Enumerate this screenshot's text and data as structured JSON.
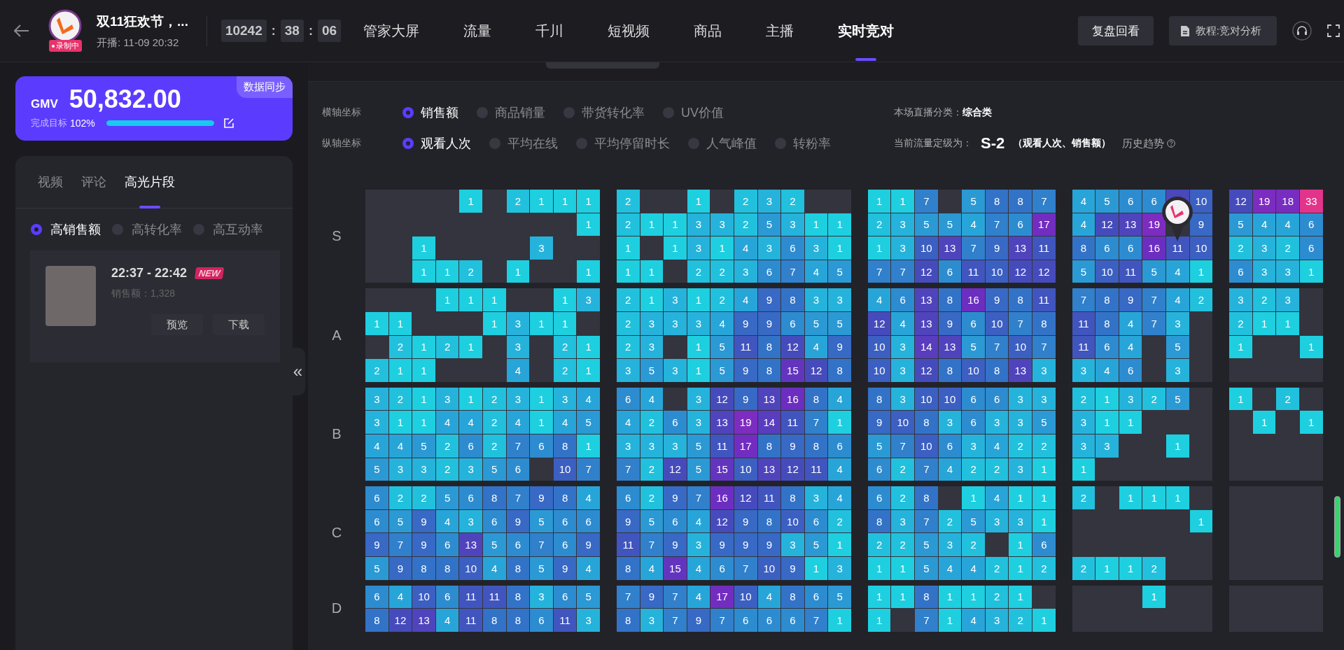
{
  "header": {
    "title": "双11狂欢节，...",
    "badge": "录制中",
    "start_time": "开播:  11-09 20:32",
    "timer": [
      {
        "text": "10242",
        "kind": "box"
      },
      {
        "text": ":",
        "kind": "sep"
      },
      {
        "text": "38",
        "kind": "box"
      },
      {
        "text": ":",
        "kind": "sep"
      },
      {
        "text": "06",
        "kind": "box"
      }
    ],
    "nav": [
      {
        "label": "管家大屏",
        "selected": false
      },
      {
        "label": "流量",
        "selected": false
      },
      {
        "label": "千川",
        "selected": false
      },
      {
        "label": "短视频",
        "selected": false
      },
      {
        "label": "商品",
        "selected": false
      },
      {
        "label": "主播",
        "selected": false
      },
      {
        "label": "实时竞对",
        "selected": true
      }
    ],
    "buttons": [
      {
        "label": "复盘回看",
        "kind": "plain"
      },
      {
        "label": "教程:竞对分析",
        "kind": "doc"
      }
    ]
  },
  "sidebar": {
    "gmv": {
      "label": "GMV",
      "value": "50,832.00",
      "sync": "数据同步",
      "target_label": "完成目标",
      "target_value": "102%",
      "level": 1
    },
    "tabs": [
      {
        "label": "视频",
        "selected": false
      },
      {
        "label": "评论",
        "selected": false
      },
      {
        "label": "高光片段",
        "selected": true
      }
    ],
    "filters": [
      {
        "label": "高销售额",
        "selected": true
      },
      {
        "label": "高转化率",
        "selected": false
      },
      {
        "label": "高互动率",
        "selected": false
      }
    ],
    "clips": [
      {
        "time": "22:37 - 22:42",
        "badge": "NEW",
        "sales": "销售额：1,328",
        "actions": [
          "预览",
          "下载"
        ]
      }
    ],
    "collapse": "«"
  },
  "filters": [
    {
      "label": "横轴坐标",
      "options": [
        {
          "label": "销售额",
          "selected": true
        },
        {
          "label": "商品销量",
          "selected": false
        },
        {
          "label": "带货转化率",
          "selected": false
        },
        {
          "label": "UV价值",
          "selected": false
        }
      ]
    },
    {
      "label": "纵轴坐标",
      "options": [
        {
          "label": "观看人次",
          "selected": true
        },
        {
          "label": "平均在线",
          "selected": false
        },
        {
          "label": "平均停留时长",
          "selected": false
        },
        {
          "label": "人气峰值",
          "selected": false
        },
        {
          "label": "转粉率",
          "selected": false
        }
      ]
    }
  ],
  "summary": {
    "category_label": "本场直播分类：",
    "category": "综合类",
    "grade_label": "当前流量定级为：",
    "grade": "S-2",
    "grade_basis": "（观看人次、销售额）",
    "history": "历史趋势"
  },
  "grid": {
    "rows": [
      {
        "label": "S",
        "blocks": [
          [
            [
              {
                "kind": "empty"
              },
              {
                "kind": "empty"
              },
              {
                "kind": "empty"
              },
              {
                "kind": "empty"
              },
              "1",
              {
                "kind": "empty"
              },
              "2",
              "1",
              "1",
              "1"
            ],
            [
              {
                "kind": "empty"
              },
              {
                "kind": "empty"
              },
              {
                "kind": "empty"
              },
              {
                "kind": "empty"
              },
              {
                "kind": "empty"
              },
              {
                "kind": "empty"
              },
              {
                "kind": "empty"
              },
              {
                "kind": "empty"
              },
              {
                "kind": "empty"
              },
              "1"
            ],
            [
              {
                "kind": "empty"
              },
              {
                "kind": "empty"
              },
              "1",
              {
                "kind": "empty"
              },
              {
                "kind": "empty"
              },
              {
                "kind": "empty"
              },
              {
                "kind": "empty"
              },
              "3",
              {
                "kind": "empty"
              },
              {
                "kind": "empty"
              }
            ],
            [
              {
                "kind": "empty"
              },
              {
                "kind": "empty"
              },
              "1",
              "1",
              "2",
              {
                "kind": "empty"
              },
              "1",
              {
                "kind": "empty"
              },
              {
                "kind": "empty"
              },
              "1"
            ]
          ],
          [
            [
              "2",
              {
                "kind": "empty"
              },
              {
                "kind": "empty"
              },
              "1",
              {
                "kind": "empty"
              },
              "2",
              "3",
              "2",
              {
                "kind": "empty"
              },
              {
                "kind": "empty"
              }
            ],
            [
              "2",
              "1",
              "1",
              "3",
              "3",
              "2",
              "5",
              "3",
              "1",
              "1"
            ],
            [
              "1",
              {
                "kind": "empty"
              },
              "1",
              "3",
              "1",
              "4",
              "3",
              "6",
              "3",
              "1"
            ],
            [
              "1",
              "1",
              {
                "kind": "empty"
              },
              "2",
              "2",
              "3",
              "6",
              "7",
              "4",
              "5"
            ]
          ],
          [
            [
              "1",
              "1",
              "7",
              {
                "kind": "empty"
              },
              "5",
              "8",
              "8",
              "7"
            ],
            [
              "2",
              "3",
              "5",
              "5",
              "4",
              "7",
              "6",
              "17"
            ],
            [
              "1",
              "3",
              "10",
              "13",
              "7",
              "9",
              "13",
              "11"
            ],
            [
              "7",
              "7",
              "12",
              "6",
              "11",
              "10",
              "12",
              "12"
            ]
          ],
          [
            [
              "4",
              "5",
              "6",
              "6",
              {
                "kind": "pin"
              },
              "10"
            ],
            [
              "4",
              "12",
              "13",
              "19",
              {
                "kind": "empty"
              },
              "9"
            ],
            [
              "8",
              "6",
              "6",
              "16",
              "11",
              "10"
            ],
            [
              "5",
              "10",
              "11",
              "5",
              "4",
              "1"
            ]
          ],
          [
            [
              "12",
              "19",
              "18",
              "33"
            ],
            [
              "5",
              "4",
              "4",
              "6"
            ],
            [
              "2",
              "3",
              "2",
              "6"
            ],
            [
              "6",
              "3",
              "3",
              "1"
            ]
          ]
        ]
      },
      {
        "label": "A",
        "blocks": [
          [
            [
              {
                "kind": "empty"
              },
              {
                "kind": "empty"
              },
              {
                "kind": "empty"
              },
              "1",
              "1",
              "1",
              {
                "kind": "empty"
              },
              {
                "kind": "empty"
              },
              "1",
              "3"
            ],
            [
              "1",
              "1",
              {
                "kind": "empty"
              },
              {
                "kind": "empty"
              },
              {
                "kind": "empty"
              },
              "1",
              "3",
              "1",
              "1",
              {
                "kind": "empty"
              }
            ],
            [
              {
                "kind": "empty"
              },
              "2",
              "1",
              "2",
              "1",
              {
                "kind": "empty"
              },
              "3",
              {
                "kind": "empty"
              },
              "2",
              "1"
            ],
            [
              "2",
              "1",
              "1",
              {
                "kind": "empty"
              },
              {
                "kind": "empty"
              },
              {
                "kind": "empty"
              },
              "4",
              {
                "kind": "empty"
              },
              "2",
              "1"
            ]
          ],
          [
            [
              "2",
              "1",
              "3",
              "1",
              "2",
              "4",
              "9",
              "8",
              "3",
              "3"
            ],
            [
              "2",
              "3",
              "3",
              "3",
              "4",
              "9",
              "9",
              "6",
              "5",
              "5"
            ],
            [
              "2",
              "3",
              {
                "kind": "empty"
              },
              "1",
              "5",
              "11",
              "8",
              "12",
              "4",
              "9"
            ],
            [
              "3",
              "5",
              "3",
              "1",
              "5",
              "9",
              "8",
              "15",
              "12",
              "8"
            ]
          ],
          [
            [
              "4",
              "6",
              "13",
              "8",
              "16",
              "9",
              "8",
              "11"
            ],
            [
              "12",
              "4",
              "13",
              "9",
              "6",
              "10",
              "7",
              "8"
            ],
            [
              "10",
              "3",
              "14",
              "13",
              "5",
              "7",
              "10",
              "7"
            ],
            [
              "10",
              "3",
              "12",
              "8",
              "10",
              "8",
              "13",
              "3"
            ]
          ],
          [
            [
              "7",
              "8",
              "9",
              "7",
              "4",
              "2"
            ],
            [
              "11",
              "8",
              "4",
              "7",
              "3",
              {
                "kind": "empty"
              }
            ],
            [
              "11",
              "6",
              "4",
              {
                "kind": "empty"
              },
              "5",
              {
                "kind": "empty"
              }
            ],
            [
              "3",
              "4",
              "6",
              {
                "kind": "empty"
              },
              "3",
              {
                "kind": "empty"
              }
            ]
          ],
          [
            [
              "3",
              "2",
              "3",
              {
                "kind": "empty"
              }
            ],
            [
              "2",
              "1",
              "1",
              {
                "kind": "empty"
              }
            ],
            [
              "1",
              {
                "kind": "empty"
              },
              {
                "kind": "empty"
              },
              "1"
            ],
            [
              {
                "kind": "empty"
              },
              {
                "kind": "empty"
              },
              {
                "kind": "empty"
              },
              {
                "kind": "empty"
              }
            ]
          ]
        ]
      },
      {
        "label": "B",
        "blocks": [
          [
            [
              "3",
              "2",
              "1",
              "3",
              "1",
              "2",
              "3",
              "1",
              "3",
              "4"
            ],
            [
              "3",
              "1",
              "1",
              "4",
              "4",
              "2",
              "4",
              "1",
              "4",
              "5"
            ],
            [
              "4",
              "4",
              "5",
              "2",
              "6",
              "2",
              "7",
              "6",
              "8",
              "1"
            ],
            [
              "5",
              "3",
              "3",
              "2",
              "3",
              "5",
              "6",
              {
                "kind": "empty"
              },
              "10",
              "7"
            ]
          ],
          [
            [
              "6",
              "4",
              {
                "kind": "empty"
              },
              "3",
              "12",
              "9",
              "13",
              "16",
              "8",
              "4"
            ],
            [
              "4",
              "2",
              "6",
              "3",
              "13",
              "19",
              "14",
              "11",
              "7",
              "1"
            ],
            [
              "3",
              "3",
              "3",
              "5",
              "11",
              "17",
              "8",
              "9",
              "8",
              "6"
            ],
            [
              "7",
              "2",
              "12",
              "5",
              "15",
              "10",
              "13",
              "12",
              "11",
              "4"
            ]
          ],
          [
            [
              "8",
              "3",
              "10",
              "10",
              "6",
              "6",
              "3",
              "3"
            ],
            [
              "9",
              "10",
              "8",
              "3",
              "6",
              "3",
              "3",
              "5"
            ],
            [
              "5",
              "7",
              "10",
              "6",
              "3",
              "4",
              "2",
              "2"
            ],
            [
              "6",
              "2",
              "7",
              "4",
              "2",
              "2",
              "3",
              "1"
            ]
          ],
          [
            [
              "2",
              "1",
              "3",
              "2",
              "5",
              {
                "kind": "empty"
              }
            ],
            [
              "3",
              "1",
              "1",
              {
                "kind": "empty"
              },
              {
                "kind": "empty"
              },
              {
                "kind": "empty"
              }
            ],
            [
              "3",
              "3",
              {
                "kind": "empty"
              },
              {
                "kind": "empty"
              },
              "1",
              {
                "kind": "empty"
              }
            ],
            [
              "1",
              {
                "kind": "empty"
              },
              {
                "kind": "empty"
              },
              {
                "kind": "empty"
              },
              {
                "kind": "empty"
              },
              {
                "kind": "empty"
              }
            ]
          ],
          [
            [
              "1",
              {
                "kind": "empty"
              },
              "2",
              {
                "kind": "empty"
              }
            ],
            [
              {
                "kind": "empty"
              },
              "1",
              {
                "kind": "empty"
              },
              "1"
            ],
            [
              {
                "kind": "empty"
              },
              {
                "kind": "empty"
              },
              {
                "kind": "empty"
              },
              {
                "kind": "empty"
              }
            ],
            [
              {
                "kind": "empty"
              },
              {
                "kind": "empty"
              },
              {
                "kind": "empty"
              },
              {
                "kind": "empty"
              }
            ]
          ]
        ]
      },
      {
        "label": "C",
        "blocks": [
          [
            [
              "6",
              "2",
              "2",
              "5",
              "6",
              "8",
              "7",
              "9",
              "8",
              "4"
            ],
            [
              "6",
              "5",
              "9",
              "4",
              "3",
              "6",
              "9",
              "5",
              "6",
              "6"
            ],
            [
              "9",
              "7",
              "9",
              "6",
              "13",
              "5",
              "6",
              "7",
              "6",
              "9"
            ],
            [
              "5",
              "9",
              "8",
              "8",
              "10",
              "4",
              "8",
              "5",
              "9",
              "4"
            ]
          ],
          [
            [
              "6",
              "2",
              "9",
              "7",
              "16",
              "12",
              "11",
              "8",
              "3",
              "4"
            ],
            [
              "9",
              "5",
              "6",
              "4",
              "12",
              "9",
              "8",
              "10",
              "6",
              "2"
            ],
            [
              "11",
              "7",
              "9",
              "3",
              "9",
              "9",
              "9",
              "3",
              "5",
              "1"
            ],
            [
              "8",
              "4",
              "15",
              "4",
              "6",
              "7",
              "10",
              "9",
              "1",
              "3"
            ]
          ],
          [
            [
              "6",
              "2",
              "8",
              {
                "kind": "empty"
              },
              "1",
              "4",
              "1",
              "1"
            ],
            [
              "8",
              "3",
              "7",
              "2",
              "5",
              "3",
              "3",
              "1"
            ],
            [
              "2",
              "2",
              "5",
              "3",
              "2",
              {
                "kind": "empty"
              },
              "1",
              "6"
            ],
            [
              "1",
              "1",
              "5",
              "4",
              "4",
              "2",
              "1",
              "2"
            ]
          ],
          [
            [
              "2",
              {
                "kind": "empty"
              },
              "1",
              "1",
              "1",
              {
                "kind": "empty"
              }
            ],
            [
              {
                "kind": "empty"
              },
              {
                "kind": "empty"
              },
              {
                "kind": "empty"
              },
              {
                "kind": "empty"
              },
              {
                "kind": "empty"
              },
              "1"
            ],
            [
              {
                "kind": "empty"
              },
              {
                "kind": "empty"
              },
              {
                "kind": "empty"
              },
              {
                "kind": "empty"
              },
              {
                "kind": "empty"
              },
              {
                "kind": "empty"
              }
            ],
            [
              "2",
              "1",
              "1",
              "2",
              {
                "kind": "empty"
              },
              {
                "kind": "empty"
              }
            ]
          ],
          [
            [
              {
                "kind": "empty"
              },
              {
                "kind": "empty"
              },
              {
                "kind": "empty"
              },
              {
                "kind": "empty"
              }
            ],
            [
              {
                "kind": "empty"
              },
              {
                "kind": "empty"
              },
              {
                "kind": "empty"
              },
              {
                "kind": "empty"
              }
            ],
            [
              {
                "kind": "empty"
              },
              {
                "kind": "empty"
              },
              {
                "kind": "empty"
              },
              {
                "kind": "empty"
              }
            ],
            [
              {
                "kind": "empty"
              },
              {
                "kind": "empty"
              },
              {
                "kind": "empty"
              },
              {
                "kind": "empty"
              }
            ]
          ]
        ]
      },
      {
        "label": "D",
        "blocks": [
          [
            [
              "6",
              "4",
              "10",
              "6",
              "11",
              "11",
              "8",
              "3",
              "6",
              "5"
            ],
            [
              "8",
              "12",
              "13",
              "4",
              "11",
              "8",
              "8",
              "6",
              "11",
              "3"
            ]
          ],
          [
            [
              "7",
              "9",
              "7",
              "4",
              "17",
              "10",
              "4",
              "8",
              "6",
              "5"
            ],
            [
              "8",
              "3",
              "7",
              "9",
              "7",
              "6",
              "6",
              "6",
              "7",
              "1"
            ]
          ],
          [
            [
              "1",
              "1",
              "8",
              "1",
              "1",
              "2",
              "1",
              {
                "kind": "empty"
              }
            ],
            [
              "1",
              {
                "kind": "empty"
              },
              "7",
              "1",
              "4",
              "3",
              "2",
              "1"
            ]
          ],
          [
            [
              {
                "kind": "empty"
              },
              {
                "kind": "empty"
              },
              {
                "kind": "empty"
              },
              "1",
              {
                "kind": "empty"
              },
              {
                "kind": "empty"
              }
            ],
            [
              {
                "kind": "empty"
              },
              {
                "kind": "empty"
              },
              {
                "kind": "empty"
              },
              {
                "kind": "empty"
              },
              {
                "kind": "empty"
              },
              {
                "kind": "empty"
              }
            ]
          ],
          [
            [
              {
                "kind": "empty"
              },
              {
                "kind": "empty"
              },
              {
                "kind": "empty"
              },
              {
                "kind": "empty"
              }
            ],
            [
              {
                "kind": "empty"
              },
              {
                "kind": "empty"
              },
              {
                "kind": "empty"
              },
              {
                "kind": "empty"
              }
            ]
          ]
        ]
      }
    ]
  }
}
